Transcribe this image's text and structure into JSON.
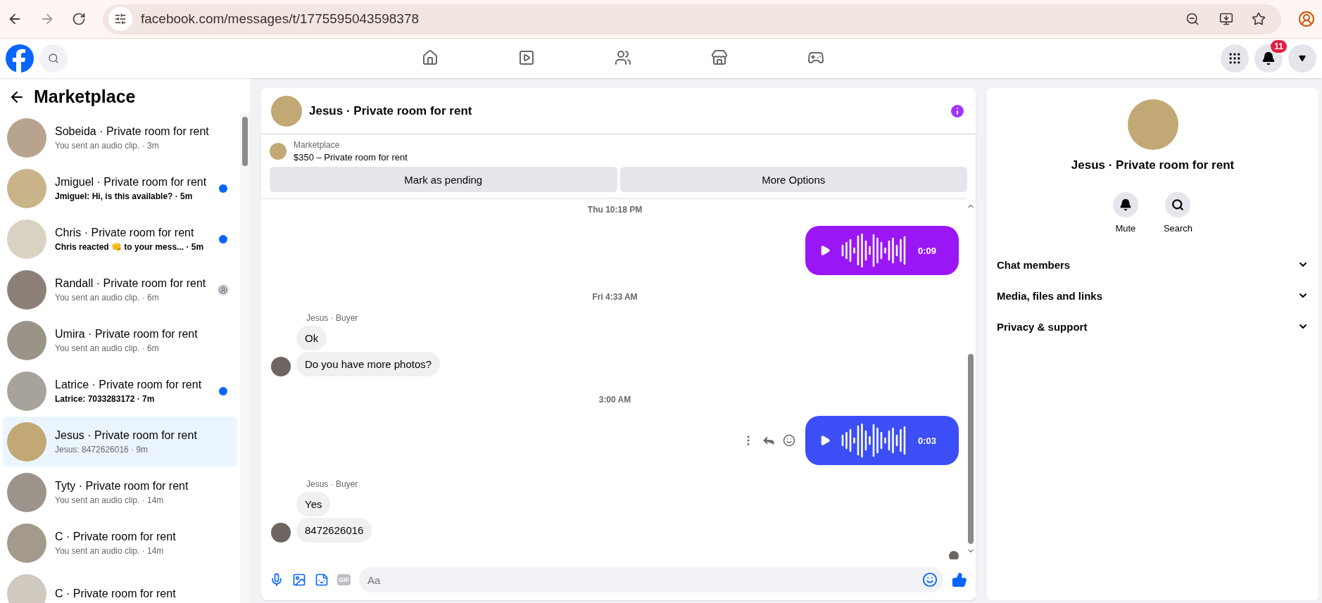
{
  "browser": {
    "url": "facebook.com/messages/t/1775595043598378"
  },
  "topnav": {
    "tabs": [
      {
        "kind": "home",
        "selected": false
      },
      {
        "kind": "reels",
        "selected": false
      },
      {
        "kind": "friends",
        "selected": false
      },
      {
        "kind": "marketplace",
        "selected": false
      },
      {
        "kind": "gaming",
        "selected": false
      }
    ],
    "notification_count": "11"
  },
  "sidebar": {
    "title": "Marketplace",
    "conversations": [
      {
        "kind": "read",
        "title": "Sobeida · Private room for rent",
        "preview": "You sent an audio clip.",
        "time": "· 3m",
        "selected": false
      },
      {
        "kind": "unread",
        "title": "Jmiguel · Private room for rent",
        "preview": "Jmiguel: Hi, is this available?",
        "time": "· 5m",
        "selected": false
      },
      {
        "kind": "unread",
        "title": "Chris · Private room for rent",
        "preview": "Chris reacted 👊 to your mess...",
        "time": "· 5m",
        "selected": false
      },
      {
        "kind": "seen",
        "title": "Randall · Private room for rent",
        "preview": "You sent an audio clip.",
        "time": "· 6m",
        "selected": false
      },
      {
        "kind": "read",
        "title": "Umira · Private room for rent",
        "preview": "You sent an audio clip.",
        "time": "· 6m",
        "selected": false
      },
      {
        "kind": "unread",
        "title": "Latrice · Private room for rent",
        "preview": "Latrice: 7033283172",
        "time": "· 7m",
        "selected": false
      },
      {
        "kind": "read",
        "title": "Jesus · Private room for rent",
        "preview": "Jesus: 8472626016",
        "time": "· 9m",
        "selected": true
      },
      {
        "kind": "read",
        "title": "Tyty · Private room for rent",
        "preview": "You sent an audio clip.",
        "time": "· 14m",
        "selected": false
      },
      {
        "kind": "read",
        "title": "C · Private room for rent",
        "preview": "You sent an audio clip.",
        "time": "· 14m",
        "selected": false
      },
      {
        "kind": "read",
        "title": "C · Private room for rent",
        "selected": false
      }
    ]
  },
  "chat": {
    "title": "Jesus · Private room for rent",
    "listing": {
      "source": "Marketplace",
      "name": "$350 – Private room for rent"
    },
    "actions": [
      "Mark as pending",
      "More Options"
    ],
    "messages": [
      {
        "kind": "timestamp",
        "text": "Thu 10:18 PM"
      },
      {
        "kind": "audio",
        "duration": "0:09",
        "color": "#9b16f5",
        "hovered": false
      },
      {
        "kind": "timestamp",
        "text": "Fri 4:33 AM"
      },
      {
        "kind": "incoming",
        "sender": "Jesus · Buyer",
        "bubbles": [
          "Ok",
          "Do you have more photos?"
        ]
      },
      {
        "kind": "timestamp",
        "text": "3:00 AM"
      },
      {
        "kind": "audio",
        "duration": "0:03",
        "color": "#3c4ef5",
        "hovered": true
      },
      {
        "kind": "incoming",
        "sender": "Jesus · Buyer",
        "bubbles": [
          "Yes",
          "8472626016"
        ]
      }
    ],
    "composer": {
      "gif_label": "GIF",
      "placeholder": "Aa"
    }
  },
  "details": {
    "title": "Jesus · Private room for rent",
    "actions": [
      {
        "kind": "mute",
        "label": "Mute"
      },
      {
        "kind": "search",
        "label": "Search"
      }
    ],
    "sections": [
      {
        "label": "Chat members",
        "expanded": false
      },
      {
        "label": "Media, files and links",
        "expanded": false
      },
      {
        "label": "Privacy & support",
        "expanded": false
      }
    ]
  }
}
